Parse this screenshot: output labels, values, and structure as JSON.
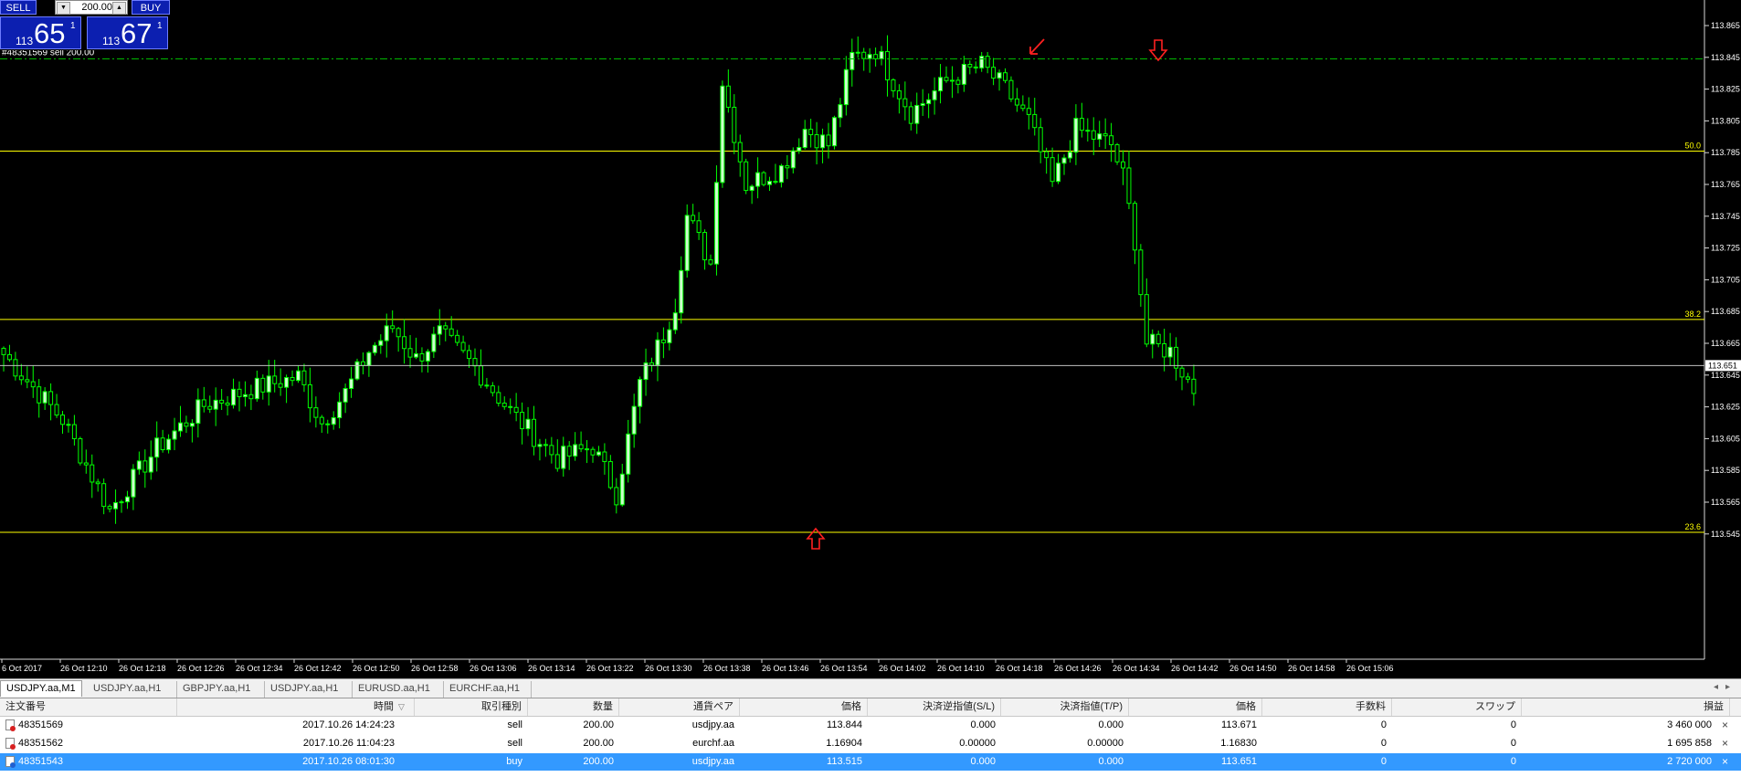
{
  "quick_trade": {
    "sell_label": "SELL",
    "buy_label": "BUY",
    "lot": "200.00",
    "sell_price": {
      "small": "113",
      "big": "65",
      "sup": "1"
    },
    "buy_price": {
      "small": "113",
      "big": "67",
      "sup": "1"
    }
  },
  "chart": {
    "order_line_label": "#48351569 sell 200.00",
    "current_price": "113.651",
    "colors": {
      "background": "#000000",
      "candle": "#00ff00",
      "bull_body": "#ccffcc",
      "bear_body": "#000000",
      "fib": "#ffff00",
      "order_line": "#00b800",
      "arrow": "#ff0000"
    }
  },
  "chart_data": {
    "type": "candlestick",
    "symbol": "USDJPY.aa,M1",
    "ylim": [
      113.535,
      113.875
    ],
    "y_ticks": [
      "113.865",
      "113.845",
      "113.825",
      "113.805",
      "113.785",
      "113.765",
      "113.745",
      "113.725",
      "113.705",
      "113.685",
      "113.665",
      "113.645",
      "113.625",
      "113.605",
      "113.585",
      "113.565",
      "113.545"
    ],
    "x_ticks": [
      "6 Oct 2017",
      "26 Oct 12:10",
      "26 Oct 12:18",
      "26 Oct 12:26",
      "26 Oct 12:34",
      "26 Oct 12:42",
      "26 Oct 12:50",
      "26 Oct 12:58",
      "26 Oct 13:06",
      "26 Oct 13:14",
      "26 Oct 13:22",
      "26 Oct 13:30",
      "26 Oct 13:38",
      "26 Oct 13:46",
      "26 Oct 13:54",
      "26 Oct 14:02",
      "26 Oct 14:10",
      "26 Oct 14:18",
      "26 Oct 14:26",
      "26 Oct 14:34",
      "26 Oct 14:42",
      "26 Oct 14:50",
      "26 Oct 14:58",
      "26 Oct 15:06"
    ],
    "fib_levels": [
      {
        "label": "50.0",
        "price": 113.786
      },
      {
        "label": "38.2",
        "price": 113.68
      },
      {
        "label": "23.6",
        "price": 113.546
      }
    ],
    "order_price": 113.844,
    "bid": 113.651,
    "close_anchors": [
      [
        0,
        113.658
      ],
      [
        10,
        113.617
      ],
      [
        18,
        113.56
      ],
      [
        26,
        113.599
      ],
      [
        34,
        113.626
      ],
      [
        42,
        113.636
      ],
      [
        50,
        113.644
      ],
      [
        54,
        113.615
      ],
      [
        58,
        113.634
      ],
      [
        62,
        113.66
      ],
      [
        66,
        113.675
      ],
      [
        70,
        113.655
      ],
      [
        74,
        113.671
      ],
      [
        80,
        113.65
      ],
      [
        86,
        113.622
      ],
      [
        94,
        113.592
      ],
      [
        100,
        113.6
      ],
      [
        104,
        113.57
      ],
      [
        108,
        113.64
      ],
      [
        112,
        113.67
      ],
      [
        114,
        113.69
      ],
      [
        116,
        113.745
      ],
      [
        120,
        113.715
      ],
      [
        122,
        113.83
      ],
      [
        126,
        113.765
      ],
      [
        132,
        113.775
      ],
      [
        136,
        113.8
      ],
      [
        140,
        113.79
      ],
      [
        144,
        113.845
      ],
      [
        148,
        113.85
      ],
      [
        154,
        113.81
      ],
      [
        160,
        113.83
      ],
      [
        166,
        113.84
      ],
      [
        170,
        113.825
      ],
      [
        174,
        113.805
      ],
      [
        178,
        113.765
      ],
      [
        182,
        113.8
      ],
      [
        188,
        113.79
      ],
      [
        190,
        113.77
      ],
      [
        192,
        113.73
      ],
      [
        194,
        113.665
      ],
      [
        198,
        113.66
      ],
      [
        202,
        113.636
      ]
    ]
  },
  "symbol_tabs": [
    "USDJPY.aa,M1",
    "USDJPY.aa,H1",
    "GBPJPY.aa,H1",
    "USDJPY.aa,H1",
    "EURUSD.aa,H1",
    "EURCHF.aa,H1"
  ],
  "trade_table": {
    "headers": [
      "注文番号",
      "時間",
      "取引種別",
      "数量",
      "通貨ペア",
      "価格",
      "決済逆指値(S/L)",
      "決済指値(T/P)",
      "価格",
      "手数料",
      "スワップ",
      "損益"
    ],
    "rows": [
      {
        "ticket": "48351569",
        "time": "2017.10.26 14:24:23",
        "type": "sell",
        "size": "200.00",
        "symbol": "usdjpy.aa",
        "price": "113.844",
        "sl": "0.000",
        "tp": "0.000",
        "current": "113.671",
        "commission": "0",
        "swap": "0",
        "profit": "3 460 000"
      },
      {
        "ticket": "48351562",
        "time": "2017.10.26 11:04:23",
        "type": "sell",
        "size": "200.00",
        "symbol": "eurchf.aa",
        "price": "1.16904",
        "sl": "0.00000",
        "tp": "0.00000",
        "current": "1.16830",
        "commission": "0",
        "swap": "0",
        "profit": "1 695 858"
      },
      {
        "ticket": "48351543",
        "time": "2017.10.26 08:01:30",
        "type": "buy",
        "size": "200.00",
        "symbol": "usdjpy.aa",
        "price": "113.515",
        "sl": "0.000",
        "tp": "0.000",
        "current": "113.651",
        "commission": "0",
        "swap": "0",
        "profit": "2 720 000"
      }
    ]
  }
}
